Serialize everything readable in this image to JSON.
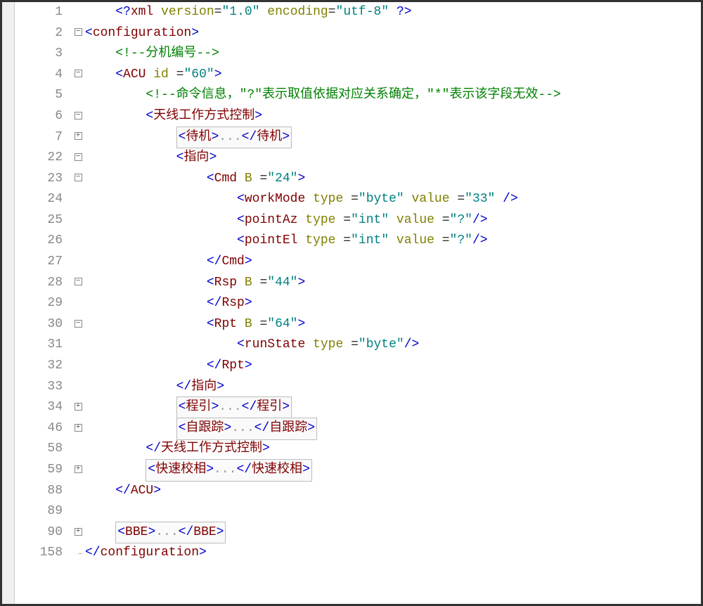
{
  "editor": {
    "lines": [
      {
        "num": "1",
        "fold": "",
        "indent": 1,
        "tokens": [
          {
            "t": "pi",
            "v": "<?"
          },
          {
            "t": "tag",
            "v": "xml "
          },
          {
            "t": "attr",
            "v": "version"
          },
          {
            "t": "eq",
            "v": "="
          },
          {
            "t": "val",
            "v": "\"1.0\" "
          },
          {
            "t": "attr",
            "v": "encoding"
          },
          {
            "t": "eq",
            "v": "="
          },
          {
            "t": "val",
            "v": "\"utf-8\" "
          },
          {
            "t": "pi",
            "v": "?>"
          }
        ]
      },
      {
        "num": "2",
        "fold": "minus",
        "indent": 0,
        "tokens": [
          {
            "t": "bracket",
            "v": "<"
          },
          {
            "t": "tag",
            "v": "configuration"
          },
          {
            "t": "bracket",
            "v": ">"
          }
        ]
      },
      {
        "num": "3",
        "fold": "line",
        "indent": 1,
        "tokens": [
          {
            "t": "comment",
            "v": "<!--分机编号-->"
          }
        ]
      },
      {
        "num": "4",
        "fold": "minus",
        "indent": 1,
        "tokens": [
          {
            "t": "bracket",
            "v": "<"
          },
          {
            "t": "tag",
            "v": "ACU "
          },
          {
            "t": "attr",
            "v": "id "
          },
          {
            "t": "eq",
            "v": "="
          },
          {
            "t": "val",
            "v": "\"60\""
          },
          {
            "t": "bracket",
            "v": ">"
          }
        ]
      },
      {
        "num": "5",
        "fold": "line",
        "indent": 2,
        "tokens": [
          {
            "t": "comment",
            "v": "<!--命令信息，\"?\"表示取值依据对应关系确定，\"*\"表示该字段无效-->"
          }
        ]
      },
      {
        "num": "6",
        "fold": "minus",
        "indent": 2,
        "tokens": [
          {
            "t": "bracket",
            "v": "<"
          },
          {
            "t": "tag",
            "v": "天线工作方式控制"
          },
          {
            "t": "bracket",
            "v": ">"
          }
        ]
      },
      {
        "num": "7",
        "fold": "plus",
        "indent": 3,
        "collapsed": true,
        "tokens": [
          {
            "t": "badge",
            "open": "待机",
            "close": "待机"
          }
        ]
      },
      {
        "num": "22",
        "fold": "minus",
        "indent": 3,
        "tokens": [
          {
            "t": "bracket",
            "v": "<"
          },
          {
            "t": "tag",
            "v": "指向"
          },
          {
            "t": "bracket",
            "v": ">"
          }
        ]
      },
      {
        "num": "23",
        "fold": "minus",
        "indent": 4,
        "tokens": [
          {
            "t": "bracket",
            "v": "<"
          },
          {
            "t": "tag",
            "v": "Cmd "
          },
          {
            "t": "attr",
            "v": "B "
          },
          {
            "t": "eq",
            "v": "="
          },
          {
            "t": "val",
            "v": "\"24\""
          },
          {
            "t": "bracket",
            "v": ">"
          }
        ]
      },
      {
        "num": "24",
        "fold": "line",
        "indent": 5,
        "tokens": [
          {
            "t": "bracket",
            "v": "<"
          },
          {
            "t": "tag",
            "v": "workMode "
          },
          {
            "t": "attr",
            "v": "type "
          },
          {
            "t": "eq",
            "v": "="
          },
          {
            "t": "val",
            "v": "\"byte\" "
          },
          {
            "t": "attr",
            "v": "value "
          },
          {
            "t": "eq",
            "v": "="
          },
          {
            "t": "val",
            "v": "\"33\" "
          },
          {
            "t": "bracket",
            "v": "/>"
          }
        ]
      },
      {
        "num": "25",
        "fold": "line",
        "indent": 5,
        "tokens": [
          {
            "t": "bracket",
            "v": "<"
          },
          {
            "t": "tag",
            "v": "pointAz "
          },
          {
            "t": "attr",
            "v": "type "
          },
          {
            "t": "eq",
            "v": "="
          },
          {
            "t": "val",
            "v": "\"int\" "
          },
          {
            "t": "attr",
            "v": "value "
          },
          {
            "t": "eq",
            "v": "="
          },
          {
            "t": "val",
            "v": "\"?\""
          },
          {
            "t": "bracket",
            "v": "/>"
          }
        ]
      },
      {
        "num": "26",
        "fold": "line",
        "indent": 5,
        "tokens": [
          {
            "t": "bracket",
            "v": "<"
          },
          {
            "t": "tag",
            "v": "pointEl "
          },
          {
            "t": "attr",
            "v": "type "
          },
          {
            "t": "eq",
            "v": "="
          },
          {
            "t": "val",
            "v": "\"int\" "
          },
          {
            "t": "attr",
            "v": "value "
          },
          {
            "t": "eq",
            "v": "="
          },
          {
            "t": "val",
            "v": "\"?\""
          },
          {
            "t": "bracket",
            "v": "/>"
          }
        ]
      },
      {
        "num": "27",
        "fold": "line",
        "indent": 4,
        "tokens": [
          {
            "t": "bracket",
            "v": "</"
          },
          {
            "t": "tag",
            "v": "Cmd"
          },
          {
            "t": "bracket",
            "v": ">"
          }
        ]
      },
      {
        "num": "28",
        "fold": "minus",
        "indent": 4,
        "tokens": [
          {
            "t": "bracket",
            "v": "<"
          },
          {
            "t": "tag",
            "v": "Rsp "
          },
          {
            "t": "attr",
            "v": "B "
          },
          {
            "t": "eq",
            "v": "="
          },
          {
            "t": "val",
            "v": "\"44\""
          },
          {
            "t": "bracket",
            "v": ">"
          }
        ]
      },
      {
        "num": "29",
        "fold": "line",
        "indent": 4,
        "tokens": [
          {
            "t": "bracket",
            "v": "</"
          },
          {
            "t": "tag",
            "v": "Rsp"
          },
          {
            "t": "bracket",
            "v": ">"
          }
        ]
      },
      {
        "num": "30",
        "fold": "minus",
        "indent": 4,
        "tokens": [
          {
            "t": "bracket",
            "v": "<"
          },
          {
            "t": "tag",
            "v": "Rpt "
          },
          {
            "t": "attr",
            "v": "B "
          },
          {
            "t": "eq",
            "v": "="
          },
          {
            "t": "val",
            "v": "\"64\""
          },
          {
            "t": "bracket",
            "v": ">"
          }
        ]
      },
      {
        "num": "31",
        "fold": "line",
        "indent": 5,
        "tokens": [
          {
            "t": "bracket",
            "v": "<"
          },
          {
            "t": "tag",
            "v": "runState "
          },
          {
            "t": "attr",
            "v": "type "
          },
          {
            "t": "eq",
            "v": "="
          },
          {
            "t": "val",
            "v": "\"byte\""
          },
          {
            "t": "bracket",
            "v": "/>"
          }
        ]
      },
      {
        "num": "32",
        "fold": "line",
        "indent": 4,
        "tokens": [
          {
            "t": "bracket",
            "v": "</"
          },
          {
            "t": "tag",
            "v": "Rpt"
          },
          {
            "t": "bracket",
            "v": ">"
          }
        ]
      },
      {
        "num": "33",
        "fold": "line",
        "indent": 3,
        "tokens": [
          {
            "t": "bracket",
            "v": "</"
          },
          {
            "t": "tag",
            "v": "指向"
          },
          {
            "t": "bracket",
            "v": ">"
          }
        ]
      },
      {
        "num": "34",
        "fold": "plus",
        "indent": 3,
        "collapsed": true,
        "tokens": [
          {
            "t": "badge",
            "open": "程引",
            "close": "程引"
          }
        ]
      },
      {
        "num": "46",
        "fold": "plus",
        "indent": 3,
        "collapsed": true,
        "tokens": [
          {
            "t": "badge",
            "open": "自跟踪",
            "close": "自跟踪"
          }
        ]
      },
      {
        "num": "58",
        "fold": "line",
        "indent": 2,
        "tokens": [
          {
            "t": "bracket",
            "v": "</"
          },
          {
            "t": "tag",
            "v": "天线工作方式控制"
          },
          {
            "t": "bracket",
            "v": ">"
          }
        ]
      },
      {
        "num": "59",
        "fold": "plus",
        "indent": 2,
        "collapsed": true,
        "tokens": [
          {
            "t": "badge",
            "open": "快速校相",
            "close": "快速校相"
          }
        ]
      },
      {
        "num": "88",
        "fold": "line",
        "indent": 1,
        "tokens": [
          {
            "t": "bracket",
            "v": "</"
          },
          {
            "t": "tag",
            "v": "ACU"
          },
          {
            "t": "bracket",
            "v": ">"
          }
        ]
      },
      {
        "num": "89",
        "fold": "line",
        "indent": 1,
        "tokens": []
      },
      {
        "num": "90",
        "fold": "plus",
        "indent": 1,
        "collapsed": true,
        "tokens": [
          {
            "t": "badge",
            "open": "BBE",
            "close": "BBE"
          }
        ]
      },
      {
        "num": "158",
        "fold": "end",
        "indent": 0,
        "tokens": [
          {
            "t": "bracket",
            "v": "</"
          },
          {
            "t": "tag",
            "v": "configuration"
          },
          {
            "t": "bracket",
            "v": ">"
          }
        ]
      }
    ]
  }
}
